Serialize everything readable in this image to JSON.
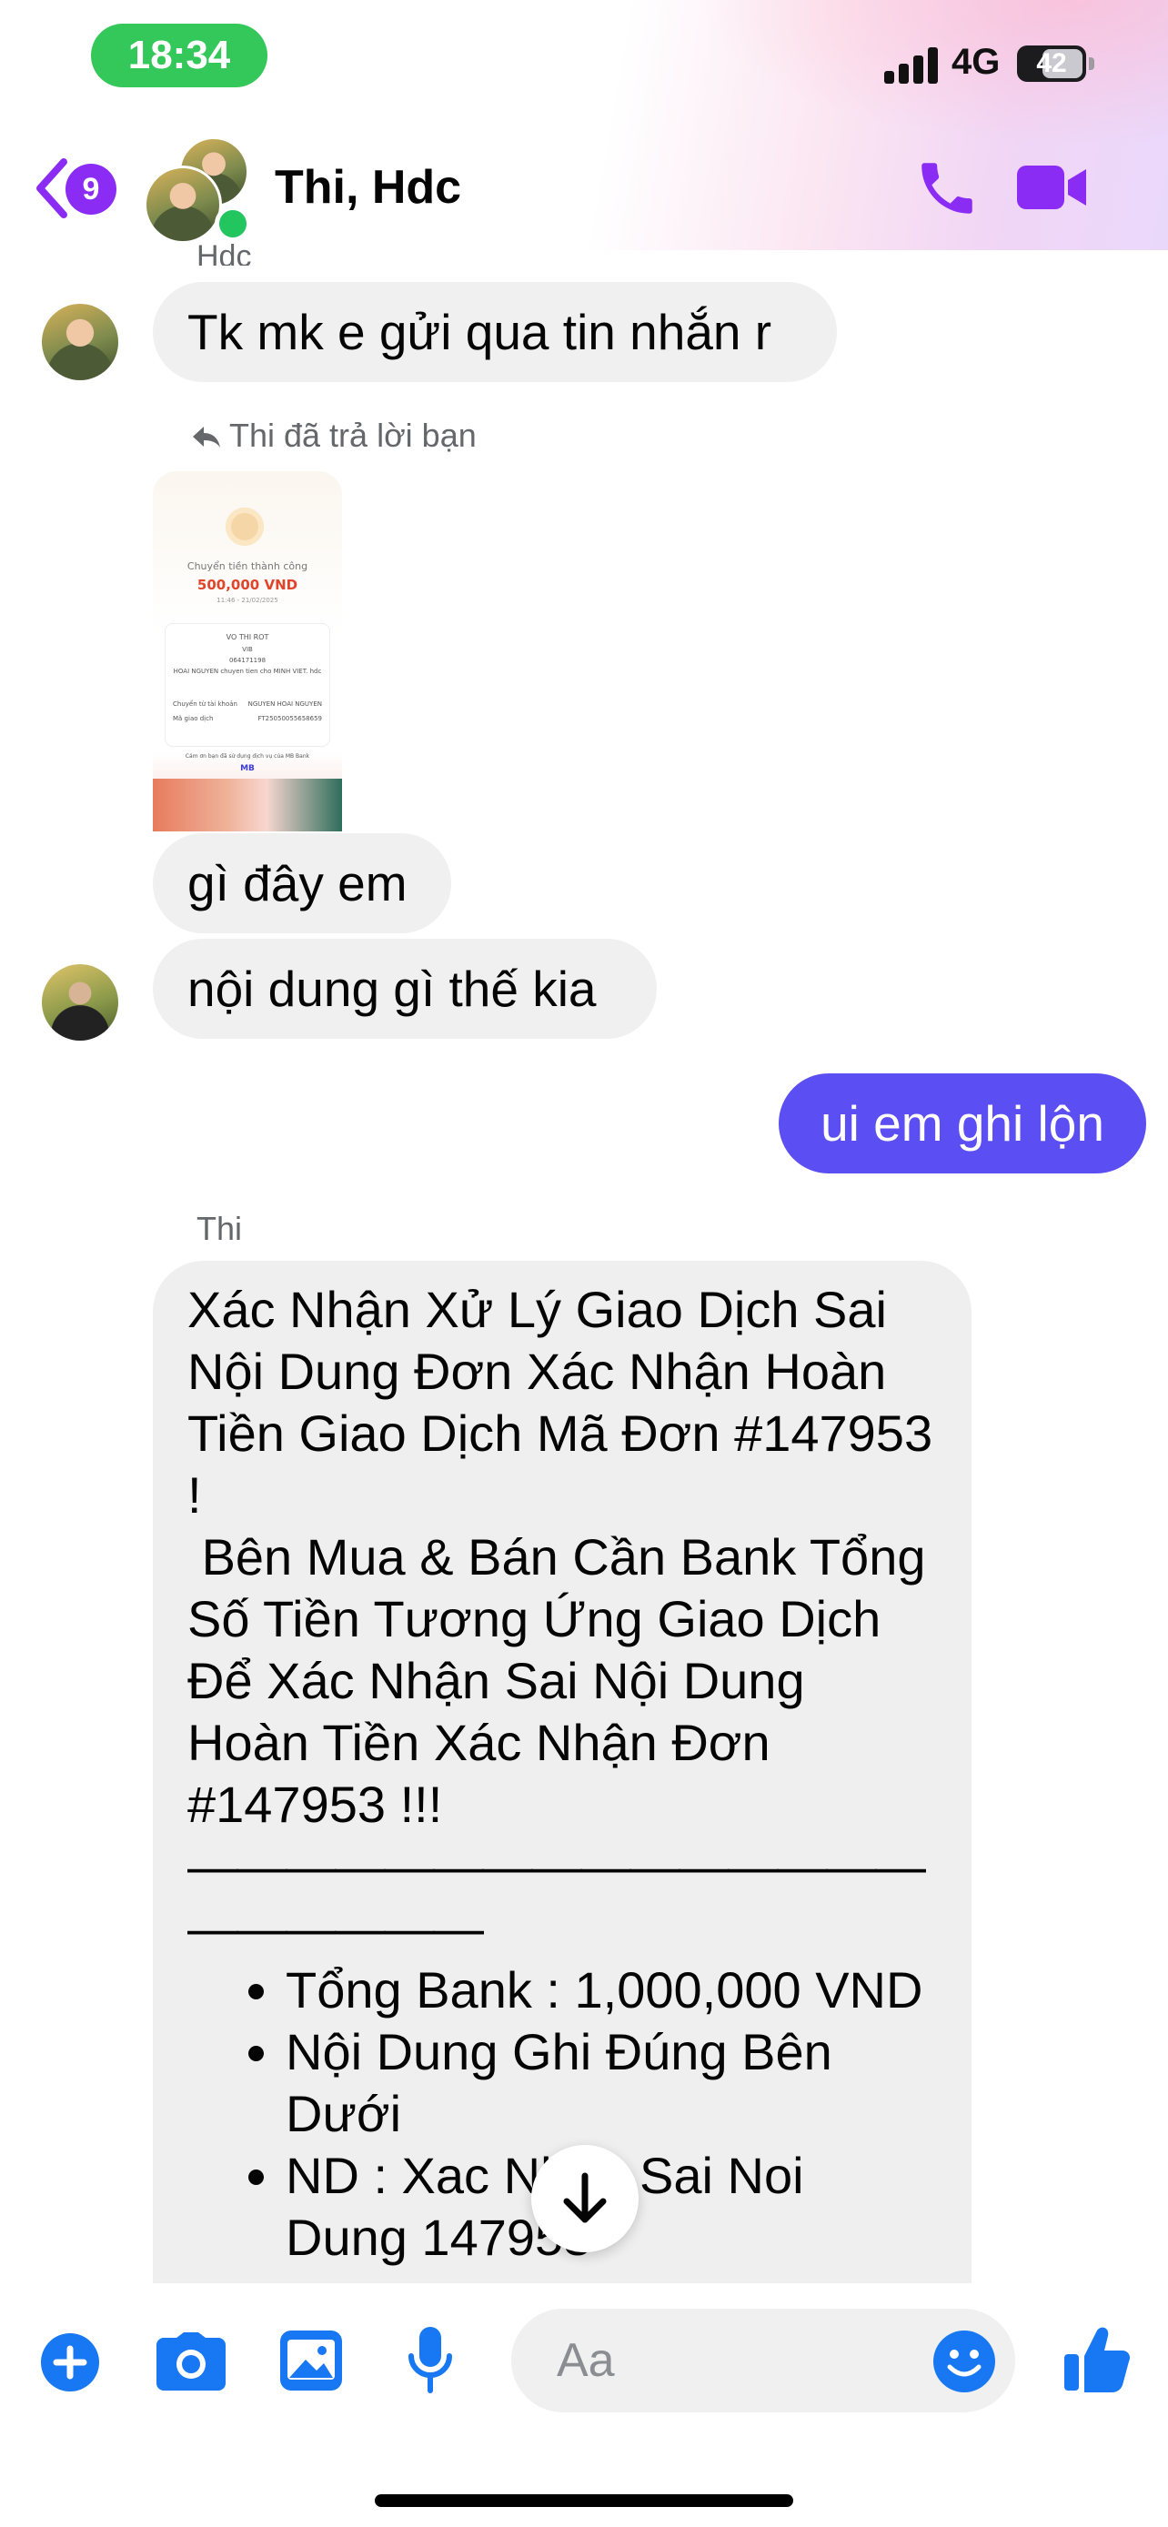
{
  "status_bar": {
    "time": "18:34",
    "network": "4G",
    "battery": "42"
  },
  "header": {
    "back_count": "9",
    "title": "Thi, Hdc"
  },
  "messages": {
    "first_sender": "Hdc",
    "m1": "Tk mk e gửi qua tin nhắn r",
    "reply_note": "Thi đã trả lời bạn",
    "screenshot": {
      "title": "Chuyển tiền thành công",
      "amount": "500,000 VND",
      "timestamp": "11:46 - 21/02/2025",
      "recipient": "VO THI ROT",
      "bank": "VIB",
      "account": "064171198",
      "memo": "HOAI NGUYEN chuyen tien cho MINH VIET. hdc",
      "from_label": "Chuyển từ tài khoản",
      "from_value": "NGUYEN HOAI NGUYEN",
      "code_label": "Mã giao dịch",
      "code_value": "FT25050055658659",
      "footer": "Cảm ơn bạn đã sử dụng dịch vụ của MB Bank",
      "brand": "MB"
    },
    "m2": "gì đây em",
    "m3": "nội dung gì thế kia",
    "sent": "ui em ghi lộn",
    "second_sender": "Thi",
    "long_message": {
      "line1": "Xác Nhận Xử Lý Giao Dịch Sai Nội Dung Đơn Xác Nhận Hoàn Tiền Giao Dịch Mã Đơn #147953 !",
      "line2": " Bên Mua & Bán Cần Bank Tổng Số Tiền Tương Ứng Giao Dịch Để Xác Nhận Sai Nội Dung Hoàn Tiền Xác Nhận Đơn #147953 !!!",
      "separator": "—————————————————————",
      "bullets": [
        "Tổng Bank : 1,000,000 VND",
        "Nội Dung Ghi Đúng Bên Dưới",
        "ND : Xac Nhan Sai Noi Dung 147953"
      ]
    }
  },
  "composer": {
    "placeholder": "Aa"
  },
  "colors": {
    "accent": "#8b2cf5",
    "sent_bubble": "#5b4ef2",
    "composer_icons": "#1877f2",
    "time_pill": "#34c759"
  }
}
